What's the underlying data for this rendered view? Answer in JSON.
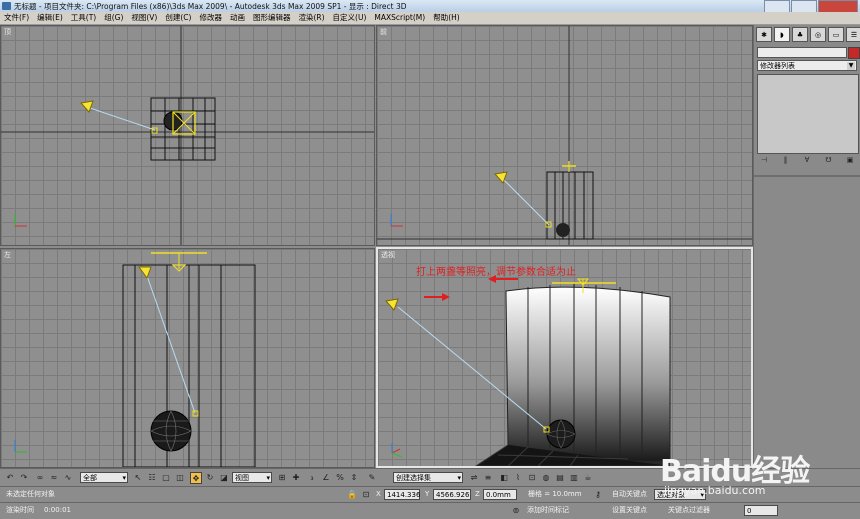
{
  "window": {
    "title": "无标题    - 项目文件夹: C:\\Program Files (x86)\\3ds Max 2009\\    - Autodesk 3ds Max  2009 SP1     - 显示 : Direct 3D"
  },
  "menu": [
    "文件(F)",
    "编辑(E)",
    "工具(T)",
    "组(G)",
    "视图(V)",
    "创建(C)",
    "修改器",
    "动画",
    "图形编辑器",
    "渲染(R)",
    "自定义(U)",
    "MAXScript(M)",
    "帮助(H)"
  ],
  "viewports": {
    "top": {
      "label": "顶"
    },
    "front": {
      "label": "前"
    },
    "left": {
      "label": "左"
    },
    "perspective": {
      "label": "透视"
    }
  },
  "annotation": {
    "text": "打上两盏等照亮，调节参数合适为止",
    "color": "#e02020"
  },
  "command_panel": {
    "tab_icons": [
      "display-tab-icon",
      "modify-tab-icon",
      "hierarchy-tab-icon",
      "motion-tab-icon",
      "display2-tab-icon",
      "utilities-tab-icon"
    ],
    "modifier_list": "修改器列表",
    "color_swatch": "#c62828"
  },
  "toolbar": {
    "selection_filter": "全部",
    "ref_coord": "视图",
    "named_selection": "创建选择集"
  },
  "status": {
    "selection_msg": "未选定任何对象",
    "render_time_label": "渲染时间",
    "render_time": "0:00:01",
    "x_value": "1414.336",
    "y_value": "4566.926",
    "z_value": "0.0mm",
    "grid_label": "栅格 = 10.0mm",
    "add_time_tag": "添加时间标记",
    "auto_key": "自动关键点",
    "set_key": "设置关键点",
    "key_filters": "关键点过滤器",
    "selected_obj": "选定对象",
    "frame": "0"
  },
  "watermark": {
    "brand": "Baidu经验",
    "url": "jingyan.baidu.com"
  }
}
